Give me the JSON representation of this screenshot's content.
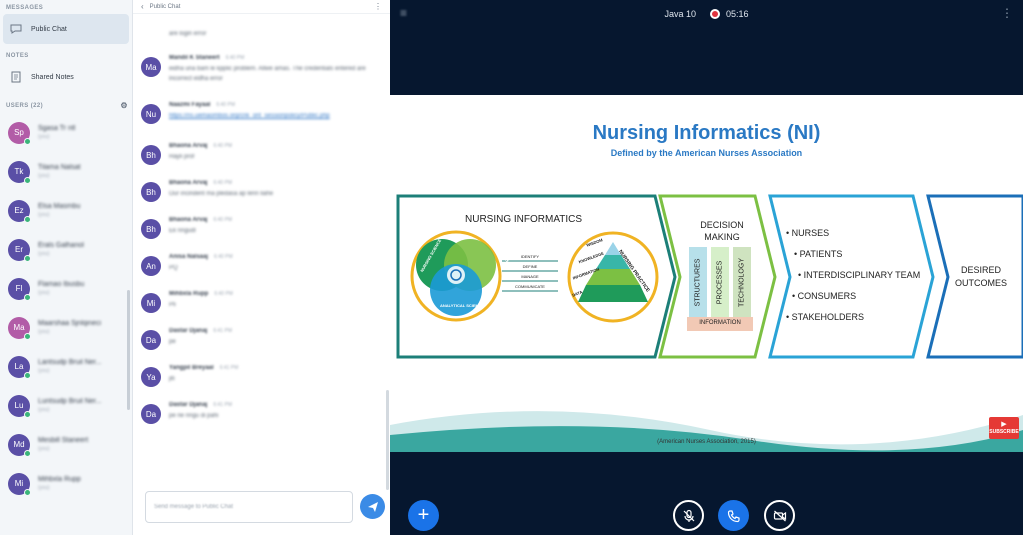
{
  "users_panel": {
    "messages_heading": "MESSAGES",
    "public_chat_label": "Public Chat",
    "notes_heading": "NOTES",
    "shared_notes_label": "Shared Notes",
    "users_heading": "USERS (22)",
    "users": [
      {
        "initials": "Sp",
        "name": "Sgasa Tr ntl",
        "status": "(you)"
      },
      {
        "initials": "Tk",
        "name": "Tilama Nalsat",
        "status": "(you)"
      },
      {
        "initials": "Ez",
        "name": "Elsa Masmbu",
        "status": "(you)"
      },
      {
        "initials": "Er",
        "name": "Erals Galhanol",
        "status": "(you)"
      },
      {
        "initials": "Fl",
        "name": "Flamao Ibusbu",
        "status": "(you)"
      },
      {
        "initials": "Ma",
        "name": "Maarshaa Sjnlqineci",
        "status": "(you)"
      },
      {
        "initials": "La",
        "name": "Lantsudp Bruil Ner...",
        "status": "(you)"
      },
      {
        "initials": "Lu",
        "name": "Luntsudp Bruil Ner...",
        "status": "(you)"
      },
      {
        "initials": "Md",
        "name": "Mesbill Staneert",
        "status": "(you)"
      },
      {
        "initials": "Mi",
        "name": "Mihbxla Rupp",
        "status": "(you)"
      }
    ]
  },
  "chat": {
    "header_title": "Public Chat",
    "messages": [
      {
        "initials": "",
        "name": "",
        "time": "",
        "text": "are login error"
      },
      {
        "initials": "Ma",
        "name": "Mandil K Staneert",
        "time": "6:40 PM",
        "text": "eidha una bam le kpplic problem. Allwe amas. The credentials entered are incorrect eidha error"
      },
      {
        "initials": "Nu",
        "name": "Naazmi Fayaal",
        "time": "6:40 PM",
        "text": "https://ns.uemaombos.org/cnk_ont_sessionpolicy/Public.php",
        "link": true
      },
      {
        "initials": "Bh",
        "name": "Bhaona Arvaj",
        "time": "6:40 PM",
        "text": "Hayli prof"
      },
      {
        "initials": "Bh",
        "name": "Bhaona Arvaj",
        "time": "6:40 PM",
        "text": "Our incindent ma pledasa ap lenn liahe"
      },
      {
        "initials": "Bh",
        "name": "Bhaona Arvaj",
        "time": "6:40 PM",
        "text": "Ek ringudl"
      },
      {
        "initials": "An",
        "name": "Anisa Nalsaaj",
        "time": "6:40 PM",
        "text": "PQ"
      },
      {
        "initials": "Mi",
        "name": "Mihbxla Rupp",
        "time": "6:40 PM",
        "text": "Pli"
      },
      {
        "initials": "Da",
        "name": "Dastar Djanaj",
        "time": "6:41 PM",
        "text": "pe"
      },
      {
        "initials": "Ya",
        "name": "Yangpil Breyaal",
        "time": "6:41 PM",
        "text": "jiti"
      },
      {
        "initials": "Da",
        "name": "Dastar Djanaj",
        "time": "6:41 PM",
        "text": "pe ne ringu di pahi"
      }
    ],
    "input_placeholder": "Send message to Public Chat"
  },
  "presentation": {
    "meeting_name": "Java 10",
    "recording_time": "05:16",
    "slide": {
      "title": "Nursing Informatics (NI)",
      "subtitle": "Defined by the American Nurses Association",
      "ni_heading": "NURSING INFORMATICS",
      "venn": [
        "NURSING SCIENCE",
        "INFORMATION SCIENCE",
        "ANALYTICAL SCIENCE"
      ],
      "flow_steps": [
        "IDENTIFY",
        "DEFINE",
        "MANAGE",
        "COMMUNICATE"
      ],
      "pyramid": [
        "WISDOM",
        "KNOWLEDGE",
        "INFORMATION",
        "DATA"
      ],
      "pyramid_arc": "NURSING PRACTICE",
      "decision": {
        "heading_line1": "DECISION",
        "heading_line2": "MAKING",
        "pillars": [
          "STRUCTURES",
          "PROCESSES",
          "TECHNOLOGY"
        ],
        "base": "INFORMATION"
      },
      "stakeholders": [
        "NURSES",
        "PATIENTS",
        "INTERDISCIPLINARY TEAM",
        "CONSUMERS",
        "STAKEHOLDERS"
      ],
      "outcome_line1": "DESIRED",
      "outcome_line2": "OUTCOMES",
      "citation": "(American Nurses Association, 2015)",
      "subscribe_label": "SUBSCRIBE"
    }
  },
  "colors": {
    "accent": "#1a73e8",
    "presentation_bg": "#06172f",
    "slide_title": "#2a79c4",
    "recording": "#e0343f"
  }
}
